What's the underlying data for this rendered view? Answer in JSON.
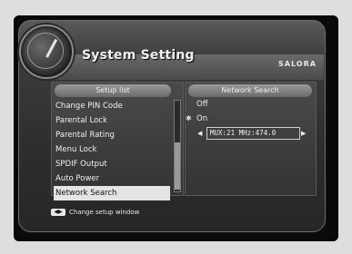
{
  "header": {
    "title": "System Setting",
    "brand": "SALORA"
  },
  "setup_list": {
    "header": "Setup list",
    "items": [
      {
        "label": "Change PIN Code"
      },
      {
        "label": "Parental Lock"
      },
      {
        "label": "Parental Rating"
      },
      {
        "label": "Menu Lock"
      },
      {
        "label": "SPDIF Output"
      },
      {
        "label": "Auto Power"
      },
      {
        "label": "Network Search"
      }
    ],
    "selected_index": 6
  },
  "detail": {
    "header": "Network Search",
    "options": [
      {
        "label": "Off"
      },
      {
        "label": "On"
      }
    ],
    "selected_option": "On",
    "mux_value": "MUX:21 MHz:474.0"
  },
  "footer": {
    "key_label": "◀▶",
    "hint": "Change setup window"
  },
  "icons": {
    "gauge": "gauge-icon",
    "left_arrow": "left-arrow-icon",
    "right_arrow": "right-arrow-icon",
    "radio": "radio-selected-icon"
  }
}
